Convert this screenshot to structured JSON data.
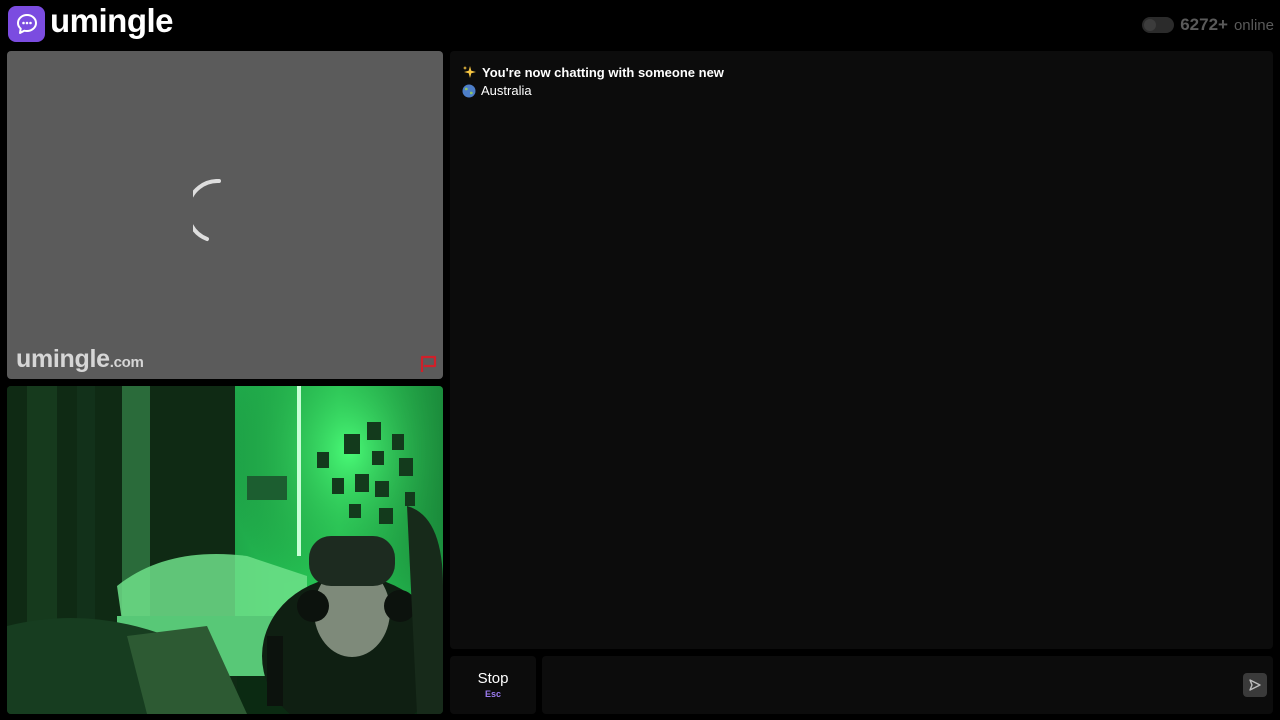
{
  "header": {
    "logo_text": "umingle",
    "online_count": "6272+",
    "online_label": "online",
    "icons": {
      "logo": "chat-bubble-icon",
      "toggle": "online-toggle"
    }
  },
  "remote_video": {
    "status": "loading",
    "watermark_name": "umingle",
    "watermark_domain": ".com",
    "icons": {
      "loading": "spinner-icon",
      "report": "report-flag-icon"
    }
  },
  "local_video": {
    "content": "user webcam feed"
  },
  "chat": {
    "system_message": "You're now chatting with someone new",
    "system_icon": "sparkles-icon",
    "country": "Australia",
    "country_icon": "globe-icon"
  },
  "controls": {
    "stop_label": "Stop",
    "stop_shortcut": "Esc",
    "message_placeholder": "",
    "send_icon": "send-icon"
  },
  "colors": {
    "accent": "#7b4ce0",
    "background": "#000000",
    "panel": "#0c0c0c",
    "remote_bg": "#5b5b5b",
    "report": "#d0202a"
  }
}
